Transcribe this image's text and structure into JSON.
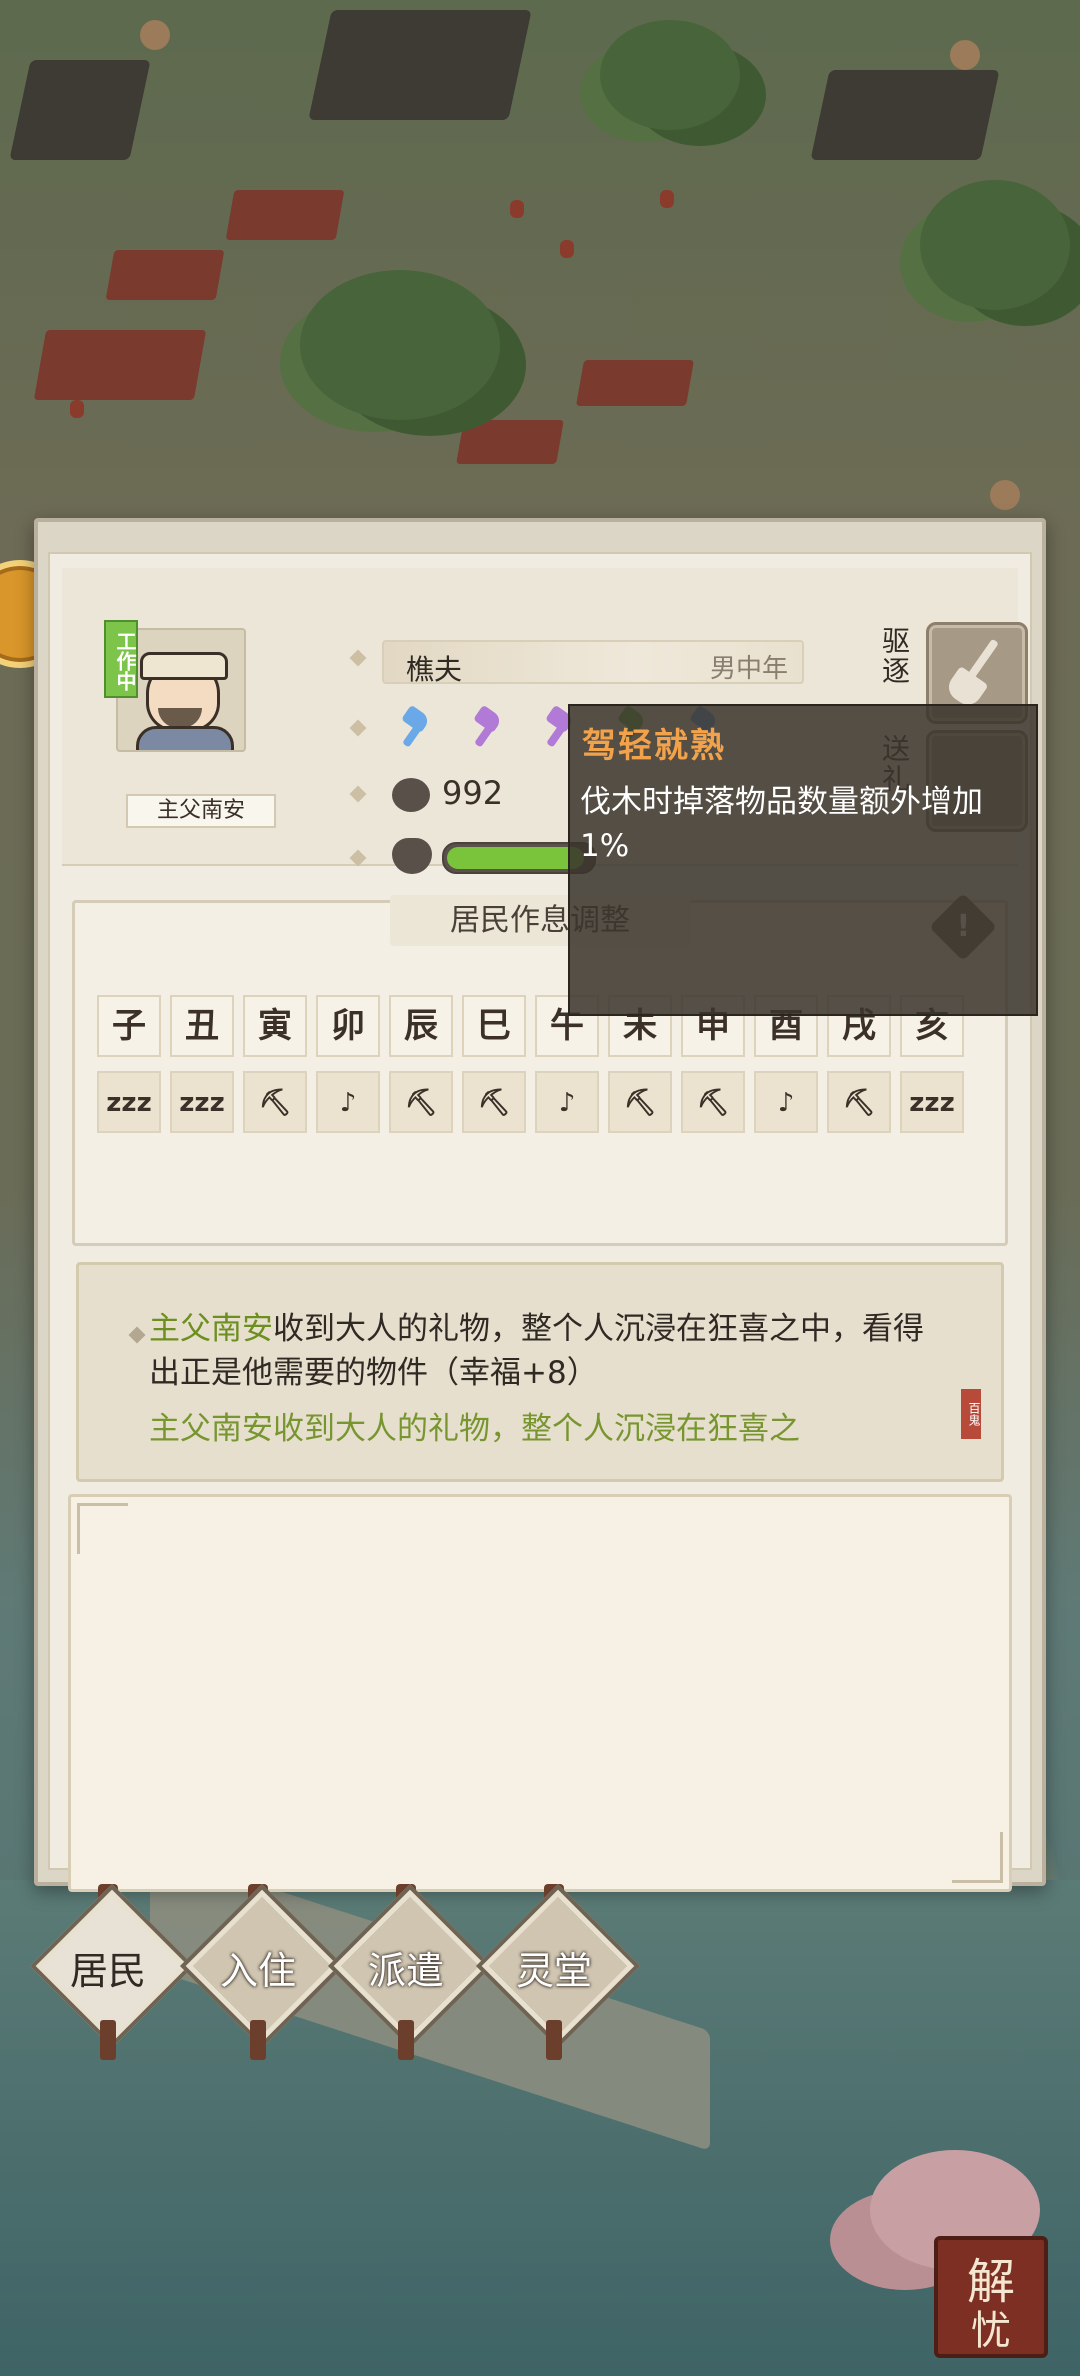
{
  "resident": {
    "status": "工作中",
    "name": "主父南安",
    "job": "樵夫",
    "age_gender": "男中年",
    "happiness": "992",
    "health_fraction": 0.95
  },
  "buttons": {
    "expel": "驱逐",
    "gift": "送礼"
  },
  "skills": [
    {
      "name": "axe-skill-1",
      "color": "#6aa8e8"
    },
    {
      "name": "axe-skill-2",
      "color": "#b07ad6"
    },
    {
      "name": "axe-skill-3",
      "color": "#b07ad6"
    },
    {
      "name": "axe-skill-4",
      "color": "#6fbf4a"
    },
    {
      "name": "axe-skill-5",
      "color": "#6aa8e8"
    }
  ],
  "schedule": {
    "title": "居民作息调整",
    "hours": [
      "子",
      "丑",
      "寅",
      "卯",
      "辰",
      "巳",
      "午",
      "未",
      "申",
      "酉",
      "戌",
      "亥"
    ],
    "activities": [
      "zzz",
      "zzz",
      "⛏",
      "♪",
      "⛏",
      "⛏",
      "♪",
      "⛏",
      "⛏",
      "♪",
      "⛏",
      "zzz"
    ]
  },
  "tooltip": {
    "title": "驾轻就熟",
    "text": "伐木时掉落物品数量额外增加1%"
  },
  "log": {
    "name": "主父南安",
    "message": "收到大人的礼物，整个人沉浸在狂喜之中，看得出正是他需要的物件（幸福+8）",
    "cut_line": "主父南安收到大人的礼物，整个人沉浸在狂喜之",
    "seal": "百鬼"
  },
  "tabs": [
    "居民",
    "入住",
    "派遣",
    "灵堂"
  ],
  "corner_button": {
    "line1": "解",
    "line2": "忧"
  }
}
